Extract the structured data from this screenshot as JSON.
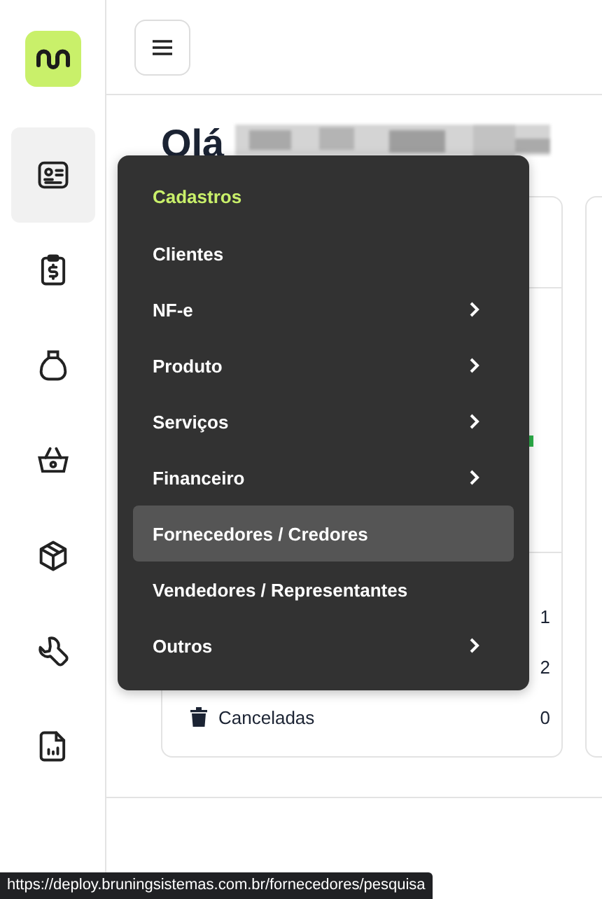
{
  "sidebar": {
    "items": [
      {
        "kind": "id-card",
        "selected": true
      },
      {
        "kind": "receipt",
        "selected": false
      },
      {
        "kind": "bag",
        "selected": false
      },
      {
        "kind": "basket",
        "selected": false
      },
      {
        "kind": "box",
        "selected": false
      },
      {
        "kind": "wrench",
        "selected": false
      },
      {
        "kind": "report",
        "selected": false
      }
    ]
  },
  "greeting": "Olá",
  "card": {
    "rows": [
      {
        "value": "1",
        "kind": "plain"
      },
      {
        "value": "2",
        "kind": "plain"
      },
      {
        "label": "Canceladas",
        "value": "0",
        "kind": "trash"
      }
    ]
  },
  "menu": {
    "title": "Cadastros",
    "items": [
      {
        "label": "Clientes",
        "has_submenu": false,
        "highlighted": false
      },
      {
        "label": "NF-e",
        "has_submenu": true,
        "highlighted": false
      },
      {
        "label": "Produto",
        "has_submenu": true,
        "highlighted": false
      },
      {
        "label": "Serviços",
        "has_submenu": true,
        "highlighted": false
      },
      {
        "label": "Financeiro",
        "has_submenu": true,
        "highlighted": false
      },
      {
        "label": "Fornecedores / Credores",
        "has_submenu": false,
        "highlighted": true
      },
      {
        "label": "Vendedores / Representantes",
        "has_submenu": false,
        "highlighted": false
      },
      {
        "label": "Outros",
        "has_submenu": true,
        "highlighted": false
      }
    ]
  },
  "status_url": "https://deploy.bruningsistemas.com.br/fornecedores/pesquisa"
}
